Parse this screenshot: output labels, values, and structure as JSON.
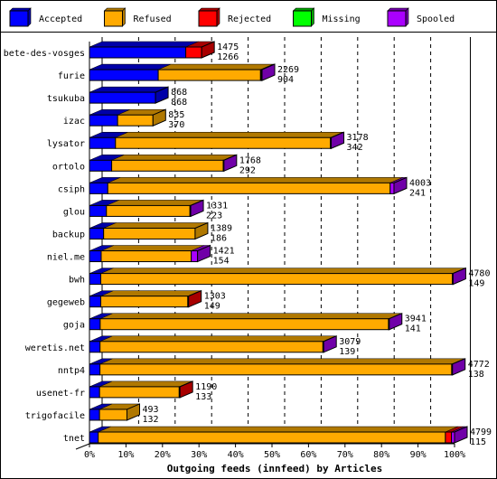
{
  "chart_data": {
    "type": "bar",
    "orientation": "horizontal",
    "stacked": true,
    "three_d": true,
    "xlabel": "Outgoing feeds (innfeed) by Articles",
    "xlim": [
      0,
      100
    ],
    "x_ticks": [
      "0%",
      "10%",
      "20%",
      "30%",
      "40%",
      "50%",
      "60%",
      "70%",
      "80%",
      "90%",
      "100%"
    ],
    "grid": true,
    "legend_position": "top",
    "legend": [
      {
        "name": "Accepted",
        "color": "#0000ff",
        "dark": "#0000a8"
      },
      {
        "name": "Refused",
        "color": "#ffaa00",
        "dark": "#b07800"
      },
      {
        "name": "Rejected",
        "color": "#ff0000",
        "dark": "#a80000"
      },
      {
        "name": "Missing",
        "color": "#00ff00",
        "dark": "#00a000"
      },
      {
        "name": "Spooled",
        "color": "#aa00ff",
        "dark": "#7000a8"
      }
    ],
    "categories": [
      "bete-des-vosges",
      "furie",
      "tsukuba",
      "izac",
      "lysator",
      "ortolo",
      "csiph",
      "glou",
      "backup",
      "niel.me",
      "bwh",
      "gegeweb",
      "goja",
      "weretis.net",
      "nntp4",
      "usenet-fr",
      "trigofacile",
      "tnet"
    ],
    "offered": [
      1475,
      2269,
      868,
      835,
      3178,
      1768,
      4003,
      1331,
      1389,
      1421,
      4780,
      1303,
      3941,
      3079,
      4772,
      1190,
      493,
      4799
    ],
    "accepted_label": [
      1266,
      904,
      868,
      370,
      342,
      292,
      241,
      223,
      186,
      154,
      149,
      149,
      141,
      139,
      138,
      133,
      132,
      115
    ],
    "series": [
      {
        "name": "Accepted",
        "values": [
          1266,
          904,
          868,
          370,
          342,
          292,
          241,
          223,
          186,
          154,
          149,
          149,
          141,
          139,
          138,
          133,
          132,
          115
        ]
      },
      {
        "name": "Refused",
        "values": [
          0,
          1345,
          0,
          465,
          2826,
          1466,
          3712,
          1098,
          1203,
          1184,
          4621,
          1144,
          3790,
          2930,
          4624,
          1047,
          361,
          4564
        ]
      },
      {
        "name": "Rejected",
        "values": [
          209,
          0,
          0,
          0,
          0,
          0,
          0,
          0,
          0,
          0,
          0,
          10,
          0,
          0,
          0,
          10,
          0,
          80
        ]
      },
      {
        "name": "Missing",
        "values": [
          0,
          10,
          0,
          0,
          0,
          0,
          0,
          0,
          0,
          0,
          0,
          0,
          0,
          0,
          0,
          0,
          0,
          0
        ]
      },
      {
        "name": "Spooled",
        "values": [
          0,
          10,
          0,
          0,
          10,
          10,
          50,
          10,
          0,
          83,
          10,
          0,
          10,
          10,
          10,
          0,
          0,
          40
        ]
      }
    ]
  }
}
